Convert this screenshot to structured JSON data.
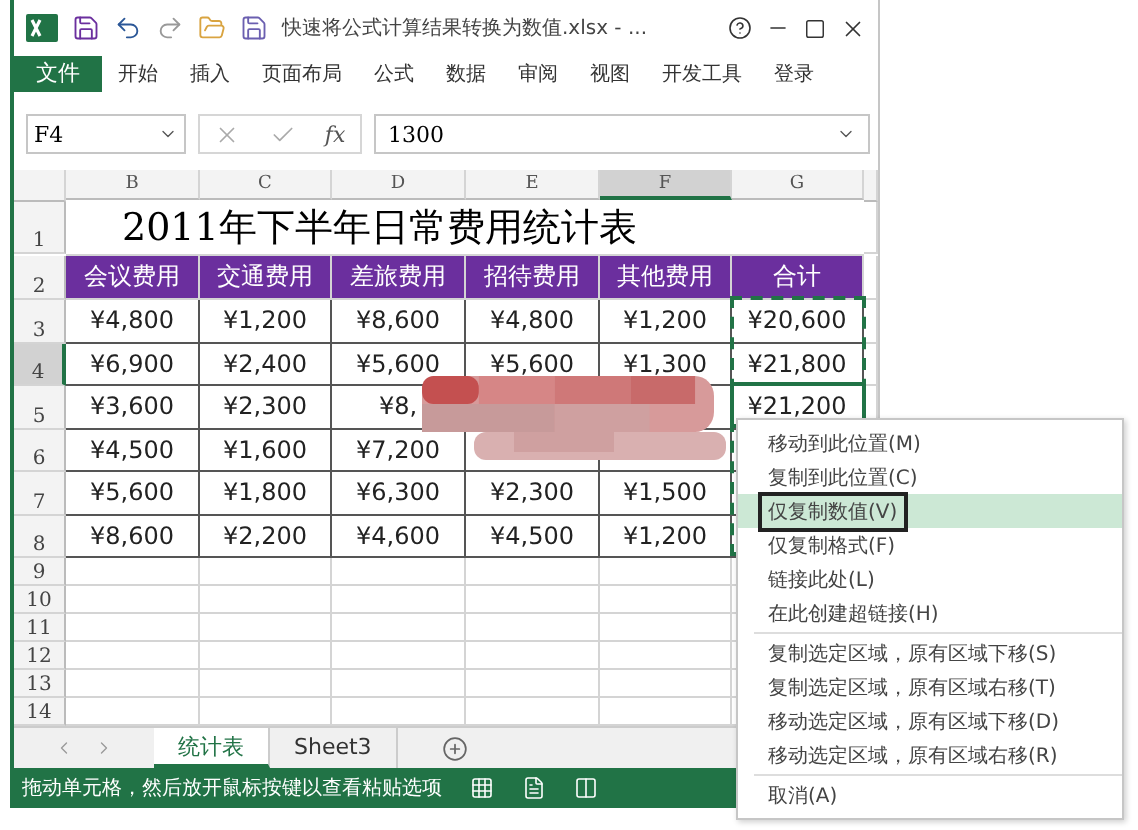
{
  "window": {
    "title": "快速将公式计算结果转换为数值.xlsx - ..."
  },
  "ribbon_tabs": [
    {
      "label": "文件",
      "kind": "file"
    },
    {
      "label": "开始",
      "kind": "tab"
    },
    {
      "label": "插入",
      "kind": "tab"
    },
    {
      "label": "页面布局",
      "kind": "tab"
    },
    {
      "label": "公式",
      "kind": "tab"
    },
    {
      "label": "数据",
      "kind": "tab"
    },
    {
      "label": "审阅",
      "kind": "tab"
    },
    {
      "label": "视图",
      "kind": "tab"
    },
    {
      "label": "开发工具",
      "kind": "tab"
    }
  ],
  "account": "登录",
  "name_box": "F4",
  "fx": "fx",
  "formula": "1300",
  "columns": [
    {
      "label": "B",
      "selected": false
    },
    {
      "label": "C",
      "selected": false
    },
    {
      "label": "D",
      "selected": false
    },
    {
      "label": "E",
      "selected": false
    },
    {
      "label": "F",
      "selected": true
    },
    {
      "label": "G",
      "selected": false
    }
  ],
  "rows": [
    {
      "label": "1",
      "selected": false,
      "kind": "title",
      "cells": [
        "2011年下半年日常费用统计表"
      ]
    },
    {
      "label": "2",
      "selected": false,
      "kind": "header",
      "cells": [
        "会议费用",
        "交通费用",
        "差旅费用",
        "招待费用",
        "其他费用",
        "合计"
      ]
    },
    {
      "label": "3",
      "selected": false,
      "kind": "data",
      "cells": [
        "¥4,800",
        "¥1,200",
        "¥8,600",
        "¥4,800",
        "¥1,200",
        "¥20,600"
      ]
    },
    {
      "label": "4",
      "selected": true,
      "kind": "data",
      "cells": [
        "¥6,900",
        "¥2,400",
        "¥5,600",
        "¥5,600",
        "¥1,300",
        "¥21,800"
      ]
    },
    {
      "label": "5",
      "selected": false,
      "kind": "data",
      "cells": [
        "¥3,600",
        "¥2,300",
        "¥8,",
        null,
        null,
        "¥21,200"
      ]
    },
    {
      "label": "6",
      "selected": false,
      "kind": "data",
      "cells": [
        "¥4,500",
        "¥1,600",
        "¥7,200",
        null,
        null,
        null
      ]
    },
    {
      "label": "7",
      "selected": false,
      "kind": "data",
      "cells": [
        "¥5,600",
        "¥1,800",
        "¥6,300",
        "¥2,300",
        "¥1,500",
        null
      ]
    },
    {
      "label": "8",
      "selected": false,
      "kind": "data",
      "cells": [
        "¥8,600",
        "¥2,200",
        "¥4,600",
        "¥4,500",
        "¥1,200",
        null
      ]
    },
    {
      "label": "9",
      "selected": false,
      "kind": "empty",
      "cells": []
    },
    {
      "label": "10",
      "selected": false,
      "kind": "empty",
      "cells": []
    },
    {
      "label": "11",
      "selected": false,
      "kind": "empty",
      "cells": []
    },
    {
      "label": "12",
      "selected": false,
      "kind": "empty",
      "cells": []
    },
    {
      "label": "13",
      "selected": false,
      "kind": "empty",
      "cells": []
    },
    {
      "label": "14",
      "selected": false,
      "kind": "empty",
      "cells": []
    }
  ],
  "sheet_tabs": [
    {
      "label": "统计表",
      "selected": true
    },
    {
      "label": "Sheet3",
      "selected": false
    }
  ],
  "status_bar": "拖动单元格，然后放开鼠标按键以查看粘贴选项",
  "context_menu": [
    {
      "label": "移动到此位置(M)",
      "selected": false,
      "separator_after": false
    },
    {
      "label": "复制到此位置(C)",
      "selected": false,
      "separator_after": false
    },
    {
      "label": "仅复制数值(V)",
      "selected": true,
      "separator_after": false
    },
    {
      "label": "仅复制格式(F)",
      "selected": false,
      "separator_after": false
    },
    {
      "label": "链接此处(L)",
      "selected": false,
      "separator_after": false
    },
    {
      "label": "在此创建超链接(H)",
      "selected": false,
      "separator_after": true
    },
    {
      "label": "复制选定区域，原有区域下移(S)",
      "selected": false,
      "separator_after": false
    },
    {
      "label": "复制选定区域，原有区域右移(T)",
      "selected": false,
      "separator_after": false
    },
    {
      "label": "移动选定区域，原有区域下移(D)",
      "selected": false,
      "separator_after": false
    },
    {
      "label": "移动选定区域，原有区域右移(R)",
      "selected": false,
      "separator_after": true
    },
    {
      "label": "取消(A)",
      "selected": false,
      "separator_after": false
    }
  ]
}
